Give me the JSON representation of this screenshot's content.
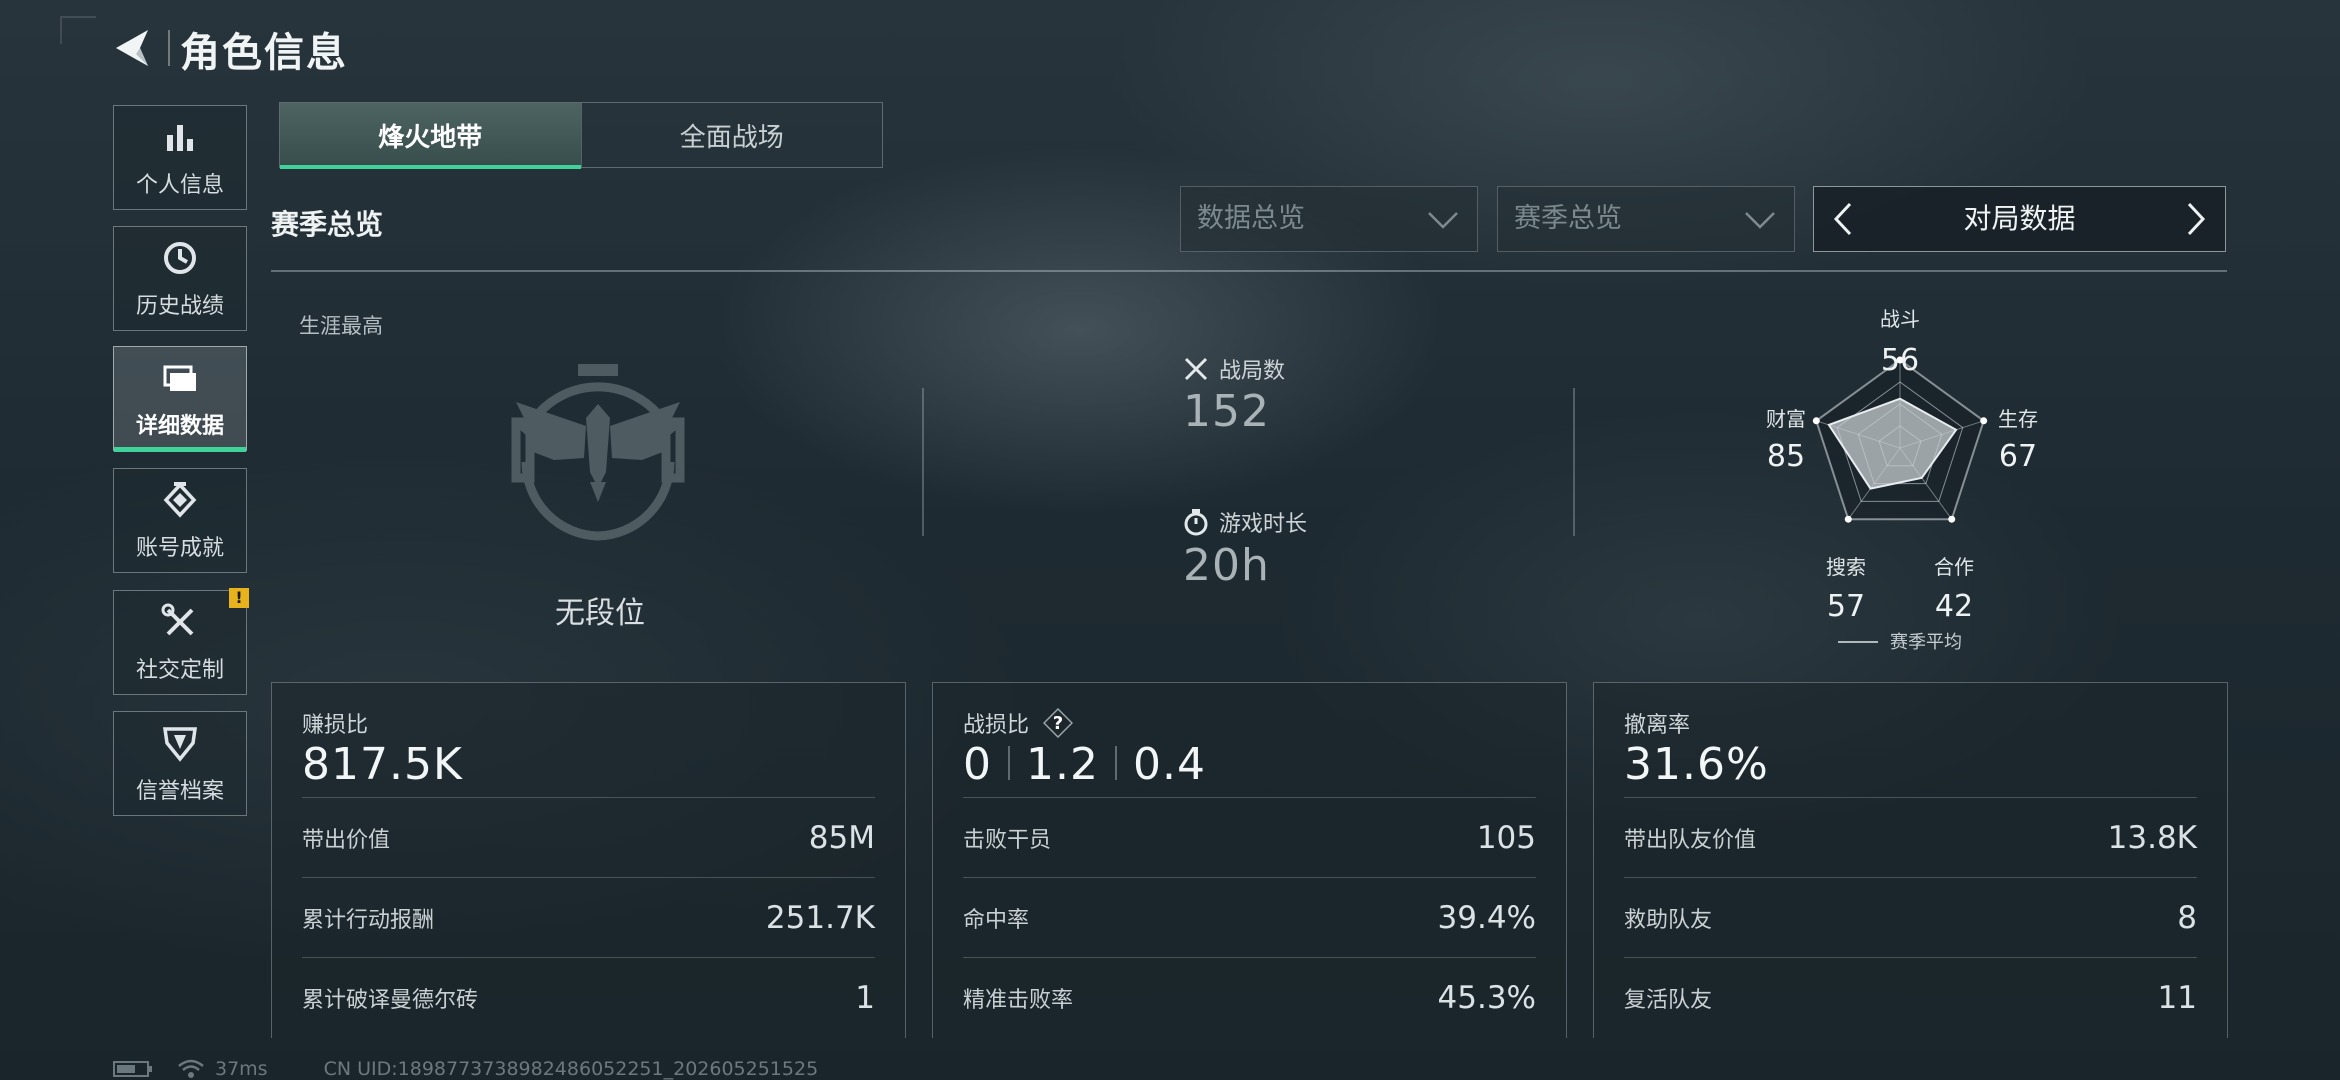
{
  "header": {
    "title": "角色信息"
  },
  "sidebar": {
    "items": [
      {
        "label": "个人信息",
        "icon": "bar-chart-icon"
      },
      {
        "label": "历史战绩",
        "icon": "history-clock-icon"
      },
      {
        "label": "详细数据",
        "icon": "folder-icon",
        "active": true
      },
      {
        "label": "账号成就",
        "icon": "medal-icon"
      },
      {
        "label": "社交定制",
        "icon": "tools-icon",
        "badge": "!"
      },
      {
        "label": "信誉档案",
        "icon": "shield-icon"
      }
    ]
  },
  "tabs": [
    {
      "label": "烽火地带",
      "active": true
    },
    {
      "label": "全面战场",
      "active": false
    }
  ],
  "section": {
    "title": "赛季总览",
    "filters": [
      {
        "value": "数据总览"
      },
      {
        "value": "赛季总览"
      }
    ],
    "pager": {
      "label": "对局数据"
    }
  },
  "overview": {
    "career_label": "生涯最高",
    "rank": "无段位",
    "matches_label": "战局数",
    "matches_value": "152",
    "playtime_label": "游戏时长",
    "playtime_value": "20h"
  },
  "radar": {
    "axes": [
      {
        "label": "战斗",
        "value": 56
      },
      {
        "label": "生存",
        "value": 67
      },
      {
        "label": "合作",
        "value": 42
      },
      {
        "label": "搜索",
        "value": 57
      },
      {
        "label": "财富",
        "value": 85
      }
    ],
    "legend": "赛季平均"
  },
  "cards": [
    {
      "label": "赚损比",
      "value": "817.5K",
      "rows": [
        {
          "label": "带出价值",
          "value": "85M"
        },
        {
          "label": "累计行动报酬",
          "value": "251.7K"
        },
        {
          "label": "累计破译曼德尔砖",
          "value": "1"
        }
      ]
    },
    {
      "label": "战损比",
      "values": [
        "0",
        "1.2",
        "0.4"
      ],
      "help": "?",
      "rows": [
        {
          "label": "击败干员",
          "value": "105"
        },
        {
          "label": "命中率",
          "value": "39.4%"
        },
        {
          "label": "精准击败率",
          "value": "45.3%"
        }
      ]
    },
    {
      "label": "撤离率",
      "value": "31.6%",
      "rows": [
        {
          "label": "带出队友价值",
          "value": "13.8K"
        },
        {
          "label": "救助队友",
          "value": "8"
        },
        {
          "label": "复活队友",
          "value": "11"
        }
      ]
    }
  ],
  "footer": {
    "ping": "37ms",
    "uid": "CN UID:1898773738982486052251_202605251525"
  }
}
